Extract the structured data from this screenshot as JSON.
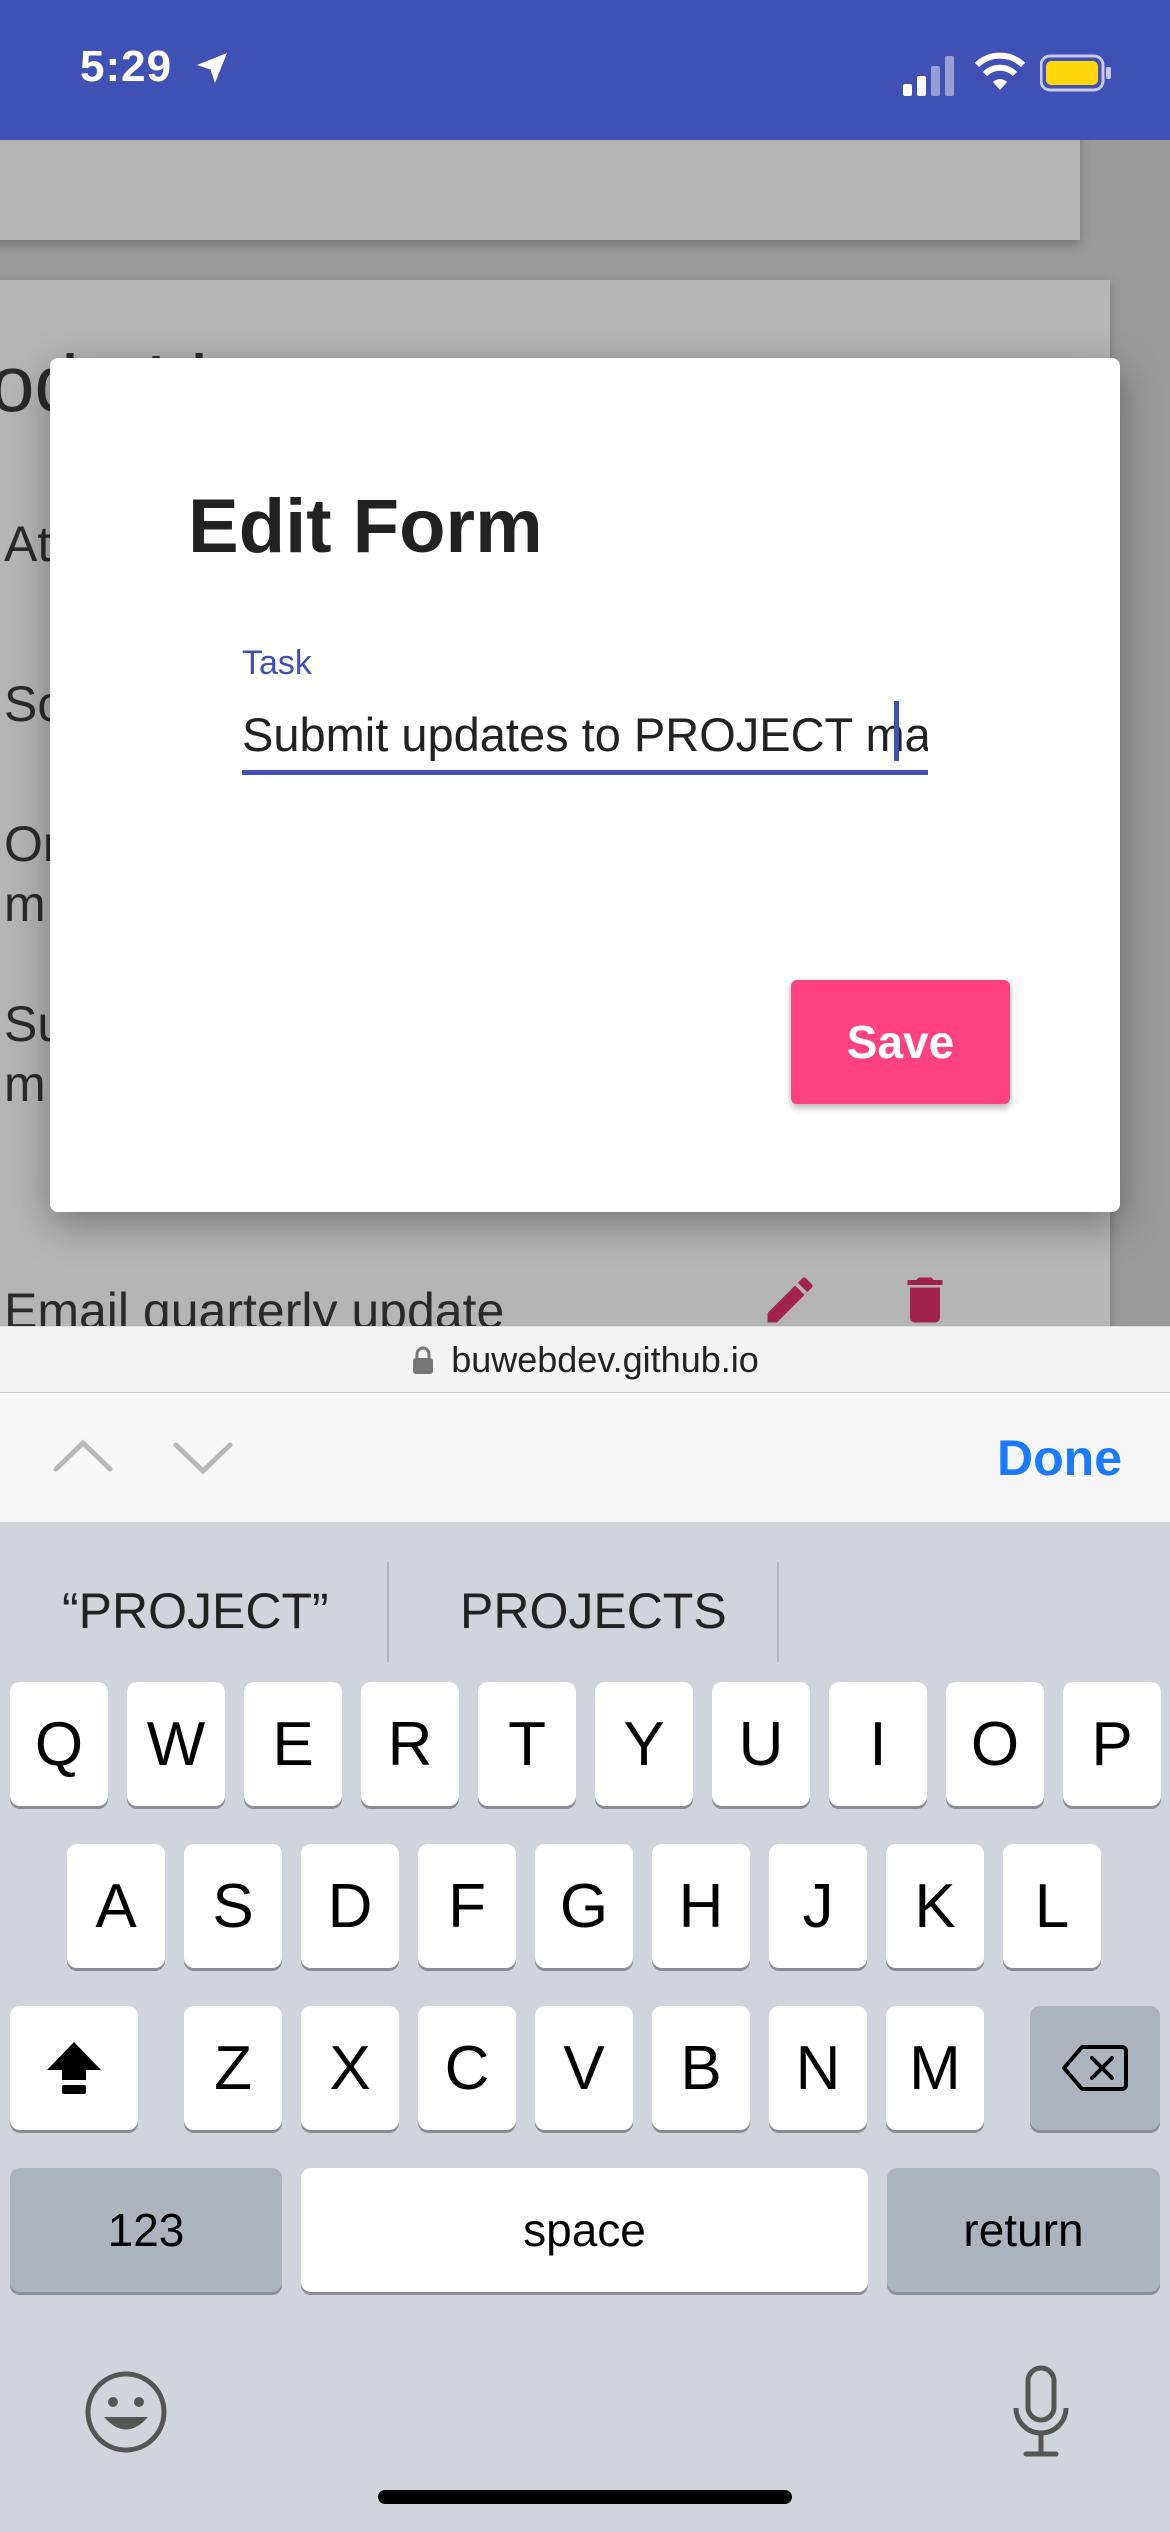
{
  "status_bar": {
    "time": "5:29"
  },
  "background_page": {
    "list_title": "ode List",
    "items": [
      "At",
      "Sc",
      "Or",
      "m",
      "Su",
      "m"
    ],
    "last_item": "Email quarterly update"
  },
  "dialog": {
    "title": "Edit Form",
    "field_label": "Task",
    "field_value": "Submit updates to PROJECT ma",
    "save_label": "Save"
  },
  "url_bar": {
    "domain": "buwebdev.github.io"
  },
  "accessory_bar": {
    "done_label": "Done"
  },
  "keyboard": {
    "suggestions": [
      "“PROJECT”",
      "PROJECTS"
    ],
    "row1": [
      "Q",
      "W",
      "E",
      "R",
      "T",
      "Y",
      "U",
      "I",
      "O",
      "P"
    ],
    "row2": [
      "A",
      "S",
      "D",
      "F",
      "G",
      "H",
      "J",
      "K",
      "L"
    ],
    "row3": [
      "Z",
      "X",
      "C",
      "V",
      "B",
      "N",
      "M"
    ],
    "numbers_label": "123",
    "space_label": "space",
    "return_label": "return"
  },
  "colors": {
    "primary": "#3f51b5",
    "accent": "#ff4081",
    "ios_blue": "#1a7bff"
  }
}
